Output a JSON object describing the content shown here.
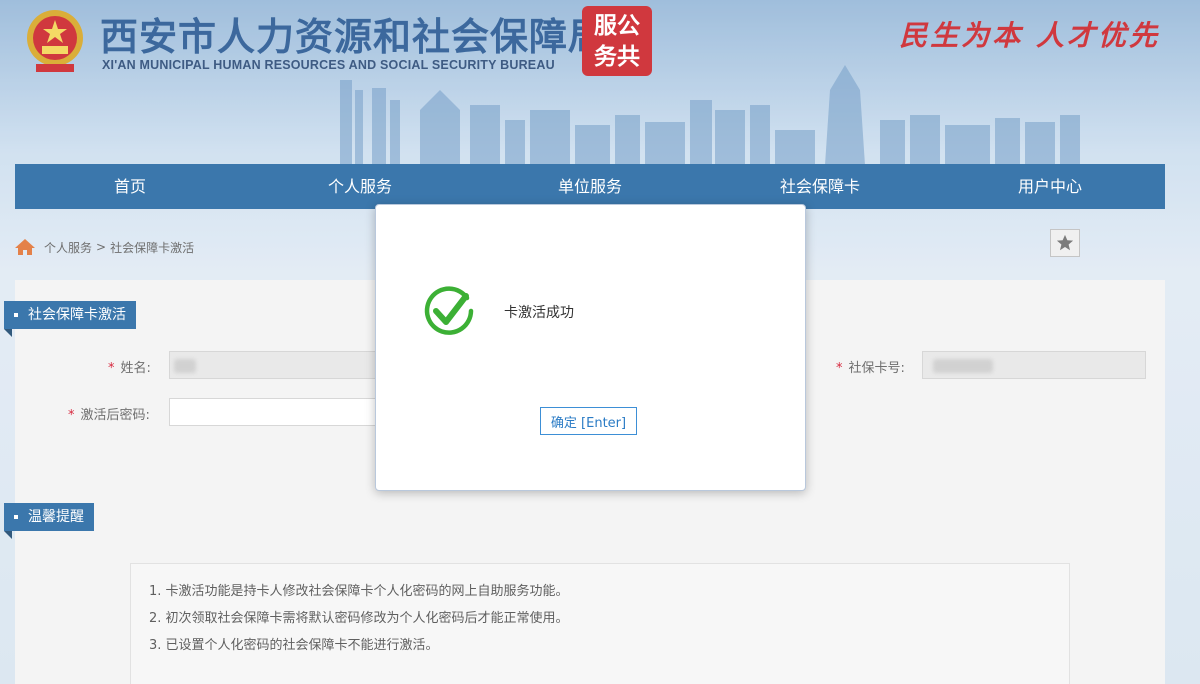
{
  "header": {
    "title": "西安市人力资源和社会保障局",
    "subtitle": "XI'AN MUNICIPAL HUMAN RESOURCES AND SOCIAL SECURITY BUREAU",
    "seal_chars": [
      "服",
      "公",
      "务",
      "共"
    ],
    "slogan": "民生为本 人才优先"
  },
  "nav": {
    "items": [
      {
        "label": "首页"
      },
      {
        "label": "个人服务"
      },
      {
        "label": "单位服务"
      },
      {
        "label": "社会保障卡"
      },
      {
        "label": "用户中心"
      }
    ]
  },
  "breadcrumb": {
    "items": [
      "个人服务",
      "社会保障卡激活"
    ],
    "separator": ">"
  },
  "section_activation": {
    "title": "社会保障卡激活"
  },
  "form": {
    "name_label": "姓名:",
    "card_no_label": "社保卡号:",
    "password_label": "激活后密码:"
  },
  "section_tips": {
    "title": "温馨提醒"
  },
  "tips": [
    "1. 卡激活功能是持卡人修改社会保障卡个人化密码的网上自助服务功能。",
    "2. 初次领取社会保障卡需将默认密码修改为个人化密码后才能正常使用。",
    "3. 已设置个人化密码的社会保障卡不能进行激活。"
  ],
  "modal": {
    "message": "卡激活成功",
    "ok_label": "确定 [Enter]"
  },
  "colors": {
    "nav_bg": "#19609e",
    "seal_red": "#c8161d",
    "success_green": "#3cb035",
    "button_blue": "#2a7bc5"
  }
}
